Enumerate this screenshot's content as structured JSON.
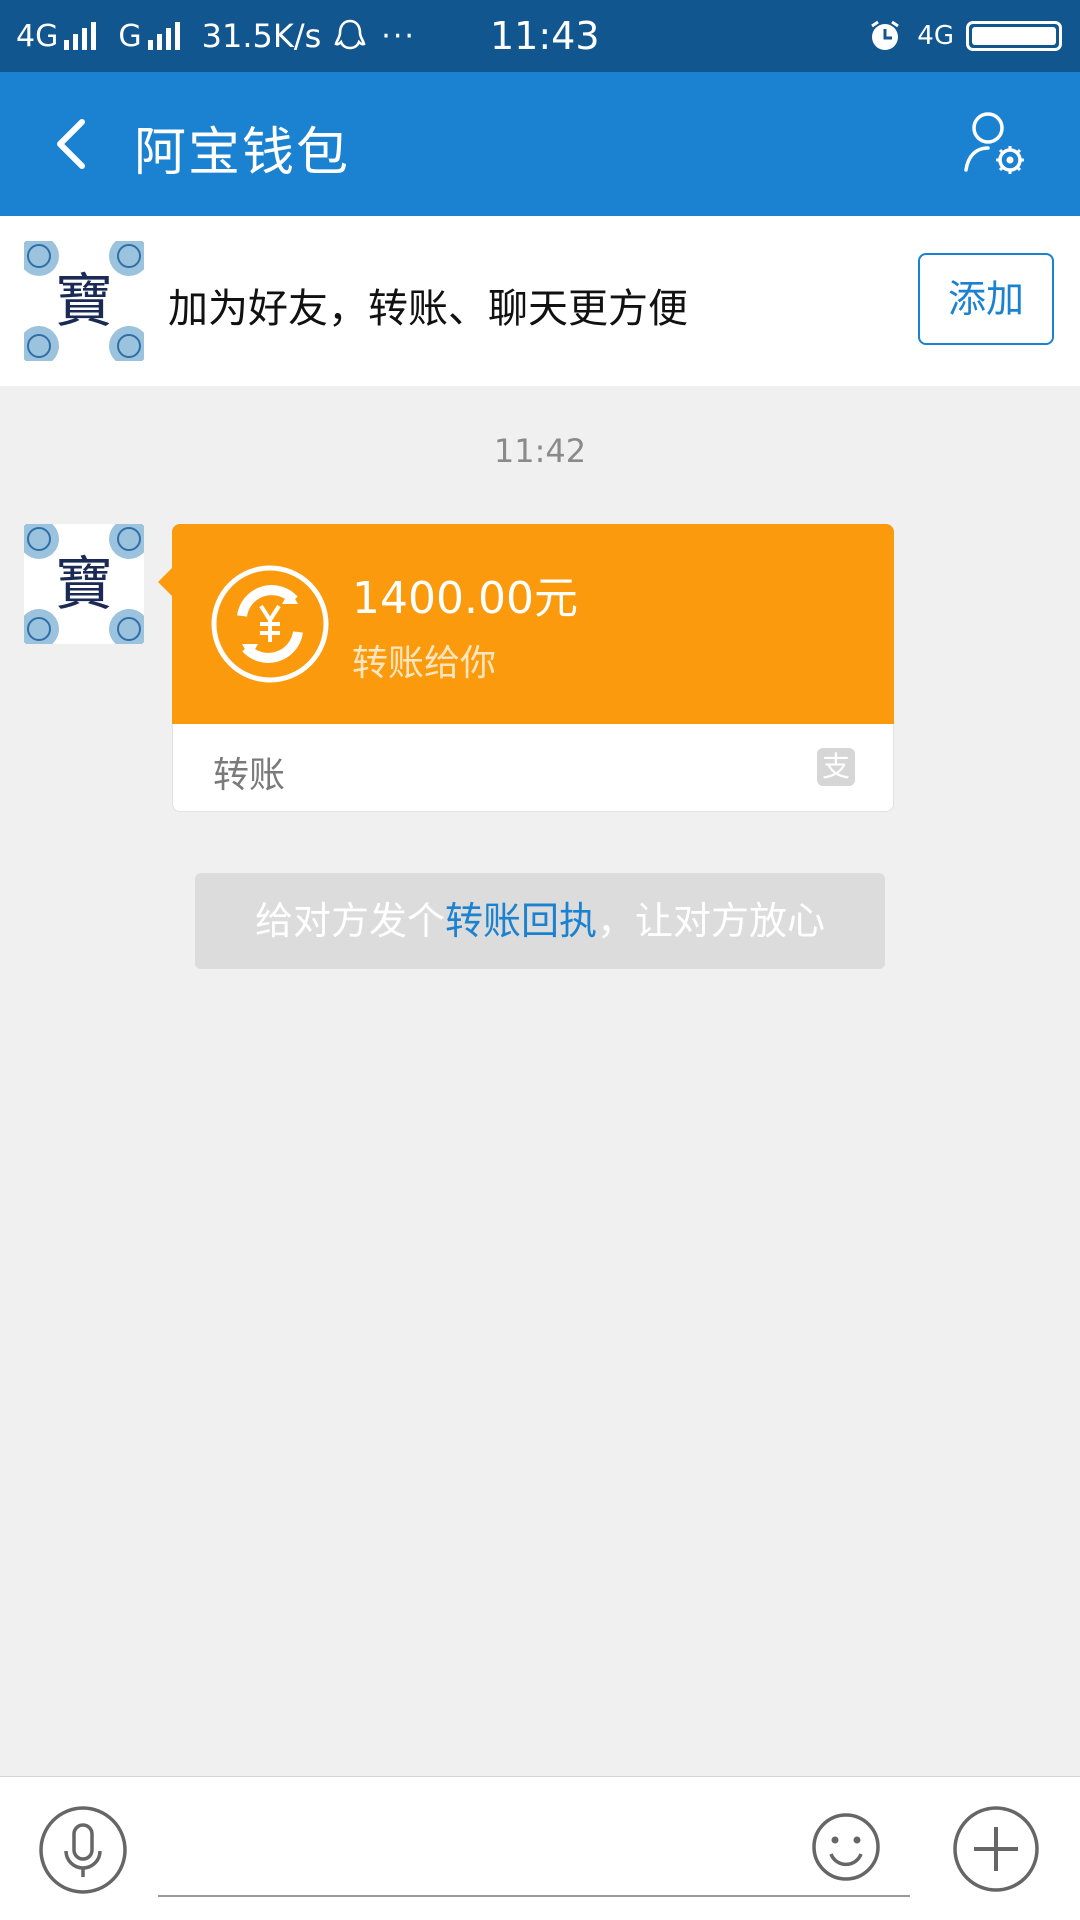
{
  "status_bar": {
    "signal1_label": "4G",
    "signal2_label": "G",
    "speed": "31.5K/s",
    "dots": "···",
    "time": "11:43",
    "network": "4G",
    "icons": [
      "qq-icon",
      "alarm-icon",
      "battery-icon"
    ]
  },
  "nav": {
    "title": "阿宝钱包",
    "back_icon": "chevron-left-icon",
    "settings_icon": "user-settings-icon"
  },
  "friend_bar": {
    "text": "加为好友，转账、聊天更方便",
    "add_label": "添加",
    "avatar_char": "寶"
  },
  "chat": {
    "timestamp": "11:42",
    "transfer": {
      "amount": "1400.00元",
      "description": "转账给你",
      "footer_label": "转账",
      "alipay_glyph": "支"
    },
    "receipt": {
      "prefix": "给对方发个",
      "link": "转账回执",
      "suffix": "，让对方放心"
    }
  },
  "input_bar": {
    "icons": [
      "microphone-icon",
      "emoji-icon",
      "plus-icon"
    ]
  },
  "colors": {
    "status_bar": "#12568f",
    "nav_bar": "#1a82d0",
    "transfer_orange": "#fb9a0c",
    "link_blue": "#1a82d0",
    "background": "#f0f0f0"
  }
}
